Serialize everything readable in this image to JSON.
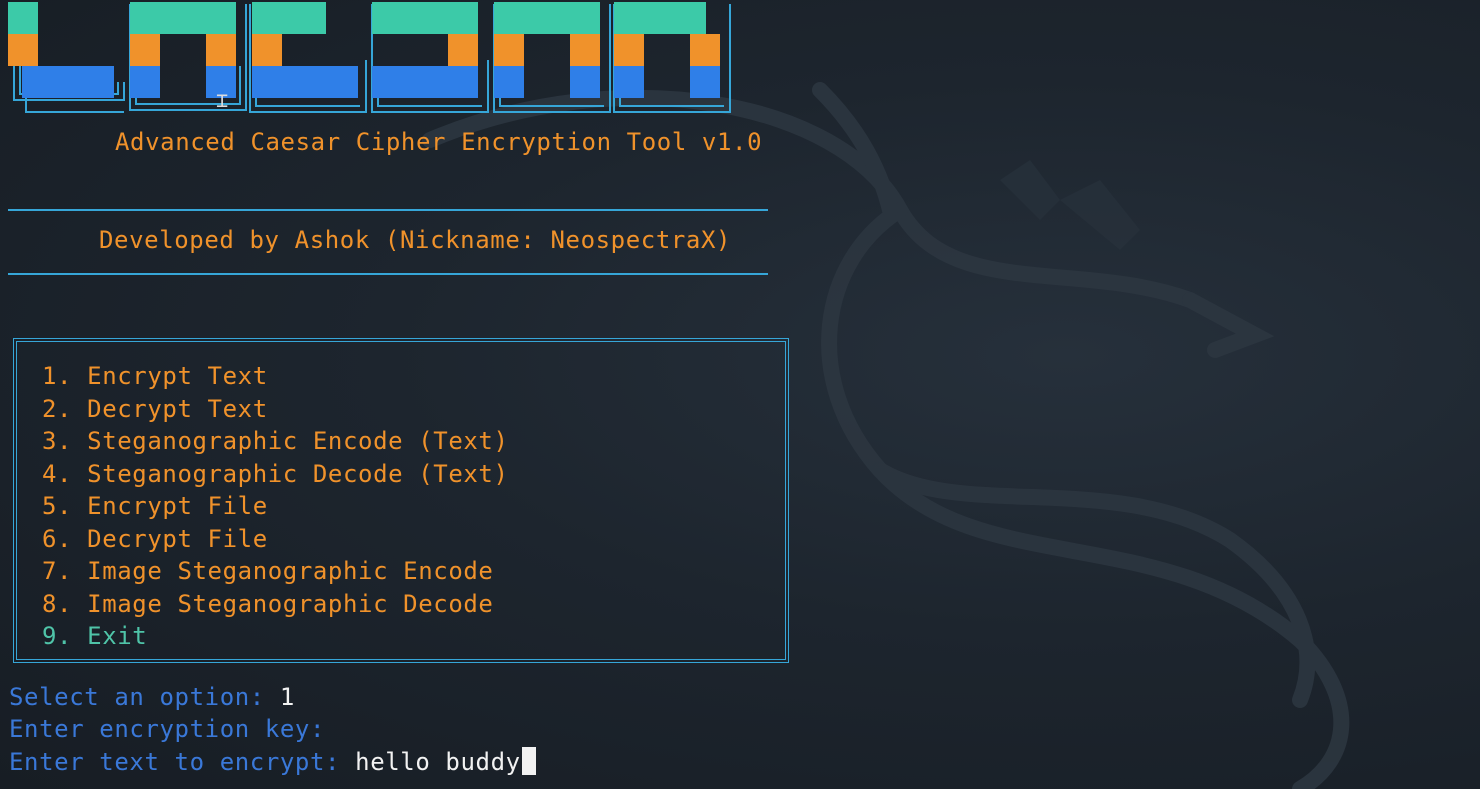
{
  "banner": {
    "subtitle": "Advanced Caesar Cipher Encryption Tool v1.0",
    "developer": "Developed by Ashok (Nickname: NeospectraX)",
    "colors": {
      "teal": "#3ccaa8",
      "orange": "#f0922b",
      "blue": "#2f7fe8",
      "rule": "#36a6d8"
    }
  },
  "menu": {
    "items": [
      {
        "label": "1. Encrypt Text"
      },
      {
        "label": "2. Decrypt Text"
      },
      {
        "label": "3. Steganographic Encode (Text)"
      },
      {
        "label": "4. Steganographic Decode (Text)"
      },
      {
        "label": "5. Encrypt File"
      },
      {
        "label": "6. Decrypt File"
      },
      {
        "label": "7. Image Steganographic Encode"
      },
      {
        "label": "8. Image Steganographic Decode"
      },
      {
        "label": "9. Exit"
      }
    ]
  },
  "prompts": {
    "select": {
      "label": "Select an option: ",
      "value": "1"
    },
    "key": {
      "label": "Enter encryption key: ",
      "value": ""
    },
    "text": {
      "label": "Enter text to encrypt: ",
      "value": "hello buddy"
    }
  },
  "cursor_icon": "i-beam-cursor-icon",
  "background_icon": "kali-dragon-icon"
}
